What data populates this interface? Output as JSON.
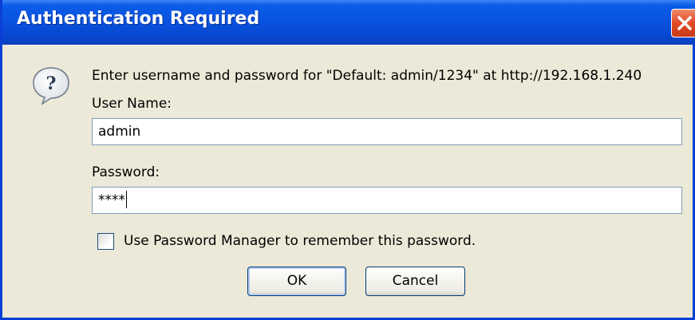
{
  "dialog": {
    "title": "Authentication Required",
    "prompt": "Enter username and password for \"Default: admin/1234\" at http://192.168.1.240",
    "username_label": "User Name:",
    "username_value": "admin",
    "password_label": "Password:",
    "password_value": "****",
    "remember_label": "Use Password Manager to remember this password.",
    "remember_checked": false,
    "ok_label": "OK",
    "cancel_label": "Cancel"
  },
  "icons": {
    "prompt_icon": "question-icon",
    "close_icon": "close-icon"
  },
  "colors": {
    "titlebar": "#0a53e0",
    "window_bg": "#ece9d8",
    "close_button": "#e04a26"
  }
}
